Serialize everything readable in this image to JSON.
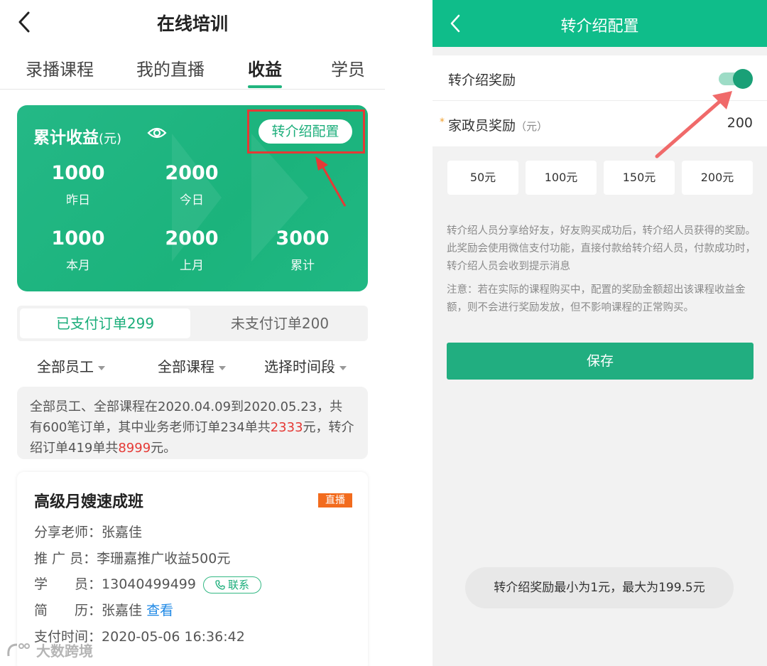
{
  "left": {
    "title": "在线培训",
    "tabs": [
      "录播课程",
      "我的直播",
      "收益",
      "学员"
    ],
    "earnings_card": {
      "title": "累计收益",
      "unit": "(元)",
      "config_button": "转介绍配置",
      "stats": [
        {
          "value": "1000",
          "label": "昨日"
        },
        {
          "value": "2000",
          "label": "今日"
        },
        {
          "value": "1000",
          "label": "本月"
        },
        {
          "value": "2000",
          "label": "上月"
        },
        {
          "value": "3000",
          "label": "累计"
        }
      ]
    },
    "order_tabs": {
      "paid": "已支付订单299",
      "unpaid": "未支付订单200"
    },
    "filters": [
      "全部员工",
      "全部课程",
      "选择时间段"
    ],
    "summary": {
      "part1": "全部员工、全部课程在2020.04.09到2020.05.23，共有600笔订单，其中业务老师订单234单共",
      "amount1": "2333",
      "part2": "元，转介绍订单419单共",
      "amount2": "8999",
      "part3": "元。"
    },
    "course": {
      "title": "高级月嫂速成班",
      "badge": "直播",
      "teacher_label": "分享老师：",
      "teacher": "张嘉佳",
      "promoter_label": "推 广 员：",
      "promoter": "李珊嘉推广收益500元",
      "student_label": "学　　员：",
      "student_phone": "13040499499",
      "contact_label": "联系",
      "resume_label": "简　　历：",
      "resume_name": "张嘉佳",
      "resume_link": "查看",
      "paytime_label": "支付时间：",
      "paytime": "2020-05-06 16:36:42"
    },
    "watermark": "大数跨境",
    "accent_color": "#1cae7b",
    "highlight_color": "#e53935"
  },
  "right": {
    "title": "转介绍配置",
    "reward_toggle_label": "转介绍奖励",
    "reward_toggle_on": true,
    "field_label": "家政员奖励",
    "field_unit": "（元）",
    "field_value": "200",
    "amount_options": [
      "50元",
      "100元",
      "150元",
      "200元"
    ],
    "description": "转介绍人员分享给好友，好友购买成功后，转介绍人员获得的奖励。此奖励会使用微信支付功能，直接付款给转介绍人员，付款成功时，转介绍人员会收到提示消息",
    "notice": "注意：若在实际的课程购买中，配置的奖励金额超出该课程收益金额，则不会进行奖励发放，但不影响课程的正常购买。",
    "save_label": "保存",
    "toast": "转介绍奖励最小为1元，最大为199.5元",
    "header_color": "#0fbd8a"
  }
}
